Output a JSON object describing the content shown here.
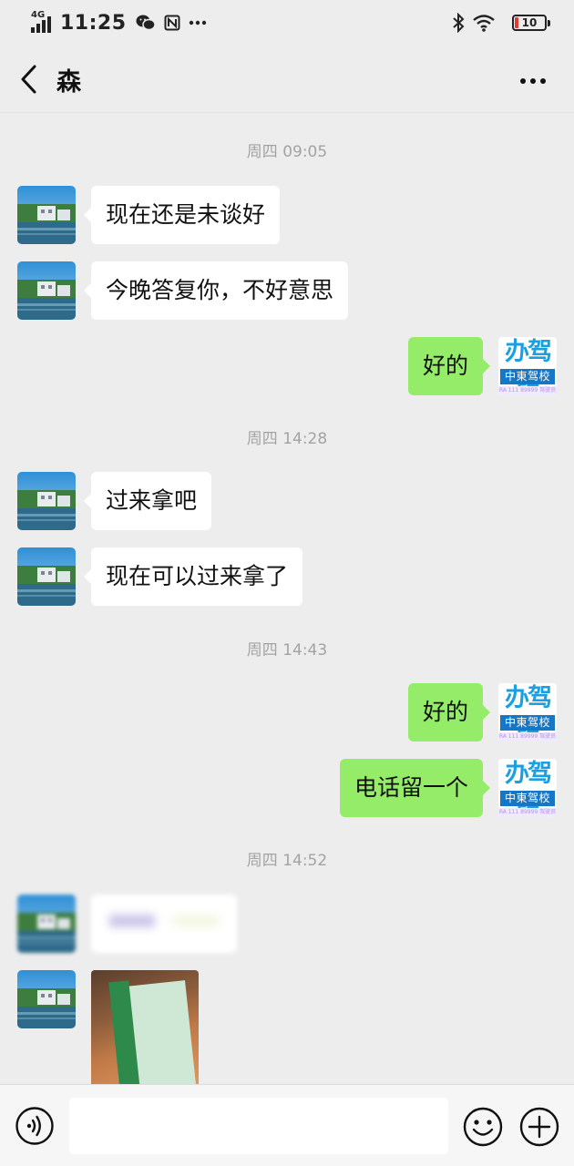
{
  "status_bar": {
    "network": "4G",
    "time": "11:25",
    "battery": "10",
    "icons": [
      "signal-icon",
      "wechat-icon",
      "nfc-icon",
      "more-dots-icon",
      "bluetooth-icon",
      "wifi-icon",
      "battery-icon"
    ]
  },
  "header": {
    "title": "森",
    "icons": [
      "back-chevron-icon",
      "more-icon"
    ]
  },
  "messages": [
    {
      "kind": "timestamp",
      "text": "周四 09:05"
    },
    {
      "kind": "received",
      "text": "现在还是未谈好"
    },
    {
      "kind": "received",
      "text": "今晚答复你，不好意思"
    },
    {
      "kind": "sent",
      "text": "好的"
    },
    {
      "kind": "timestamp",
      "text": "周四 14:28"
    },
    {
      "kind": "received",
      "text": "过来拿吧"
    },
    {
      "kind": "received",
      "text": "现在可以过来拿了"
    },
    {
      "kind": "timestamp",
      "text": "周四 14:43"
    },
    {
      "kind": "sent",
      "text": "好的"
    },
    {
      "kind": "sent",
      "text": "电话留一个"
    },
    {
      "kind": "timestamp",
      "text": "周四 14:52"
    },
    {
      "kind": "received",
      "text": "",
      "note": "blurred"
    },
    {
      "kind": "received_image",
      "text": ""
    }
  ],
  "self_avatar": {
    "line1": "办驾照",
    "line2": "中東驾校",
    "line3": "RA 111 89999 驾驶员"
  },
  "input_bar": {
    "placeholder": "",
    "icons": [
      "voice-icon",
      "emoji-icon",
      "plus-icon"
    ]
  }
}
